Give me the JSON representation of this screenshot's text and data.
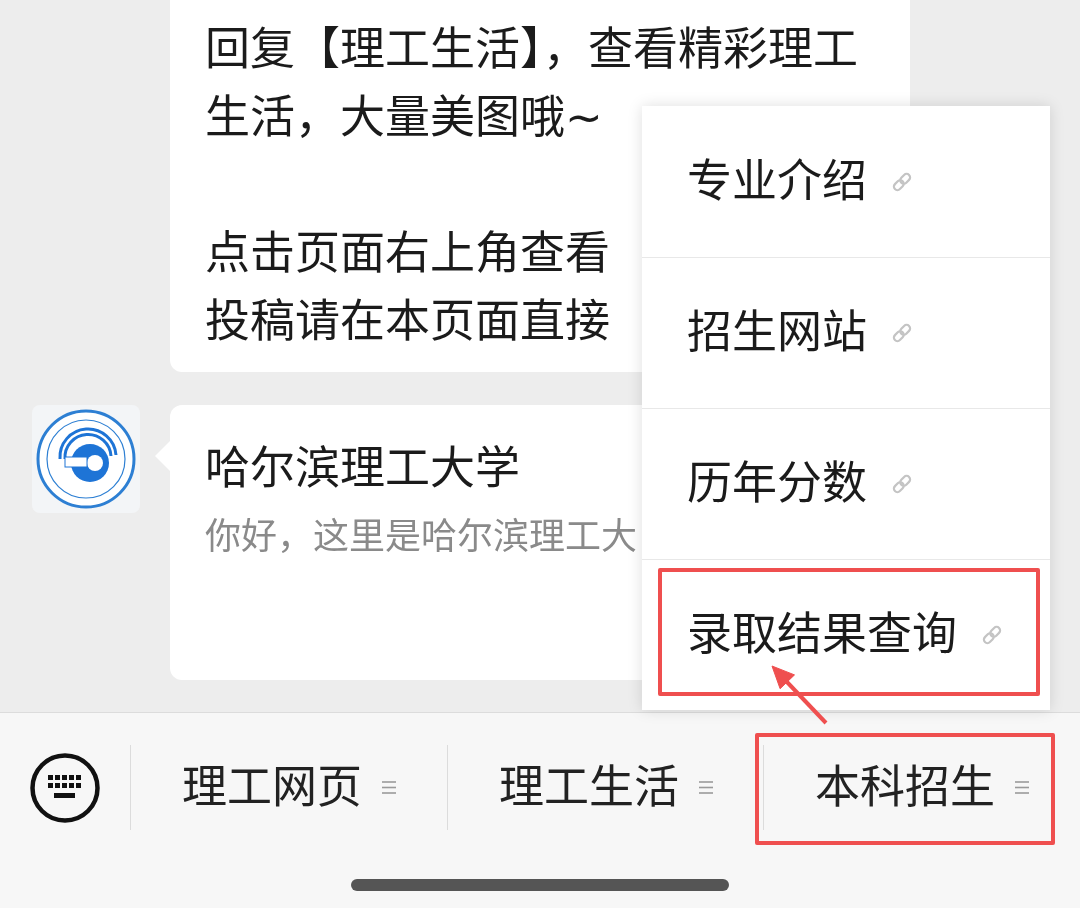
{
  "chat": {
    "messages": [
      {
        "kind": "text",
        "paragraphs": [
          [
            "回复【理工生活】，查看精彩理工",
            "生活，大量美图哦~"
          ],
          [
            "点击页面右上角查看",
            "投稿请在本页面直接"
          ]
        ]
      },
      {
        "kind": "card",
        "title": "哈尔滨理工大学",
        "description": "你好，这里是哈尔滨理工大"
      }
    ]
  },
  "popup_menu": {
    "items": [
      {
        "label": "专业介绍",
        "highlighted": false
      },
      {
        "label": "招生网站",
        "highlighted": false
      },
      {
        "label": "历年分数",
        "highlighted": false
      },
      {
        "label": "录取结果查询",
        "highlighted": true
      }
    ]
  },
  "bottom_menu": {
    "tabs": [
      {
        "label": "理工网页",
        "highlighted": false
      },
      {
        "label": "理工生活",
        "highlighted": false
      },
      {
        "label": "本科招生",
        "highlighted": true
      }
    ]
  },
  "annotation_arrow": true
}
